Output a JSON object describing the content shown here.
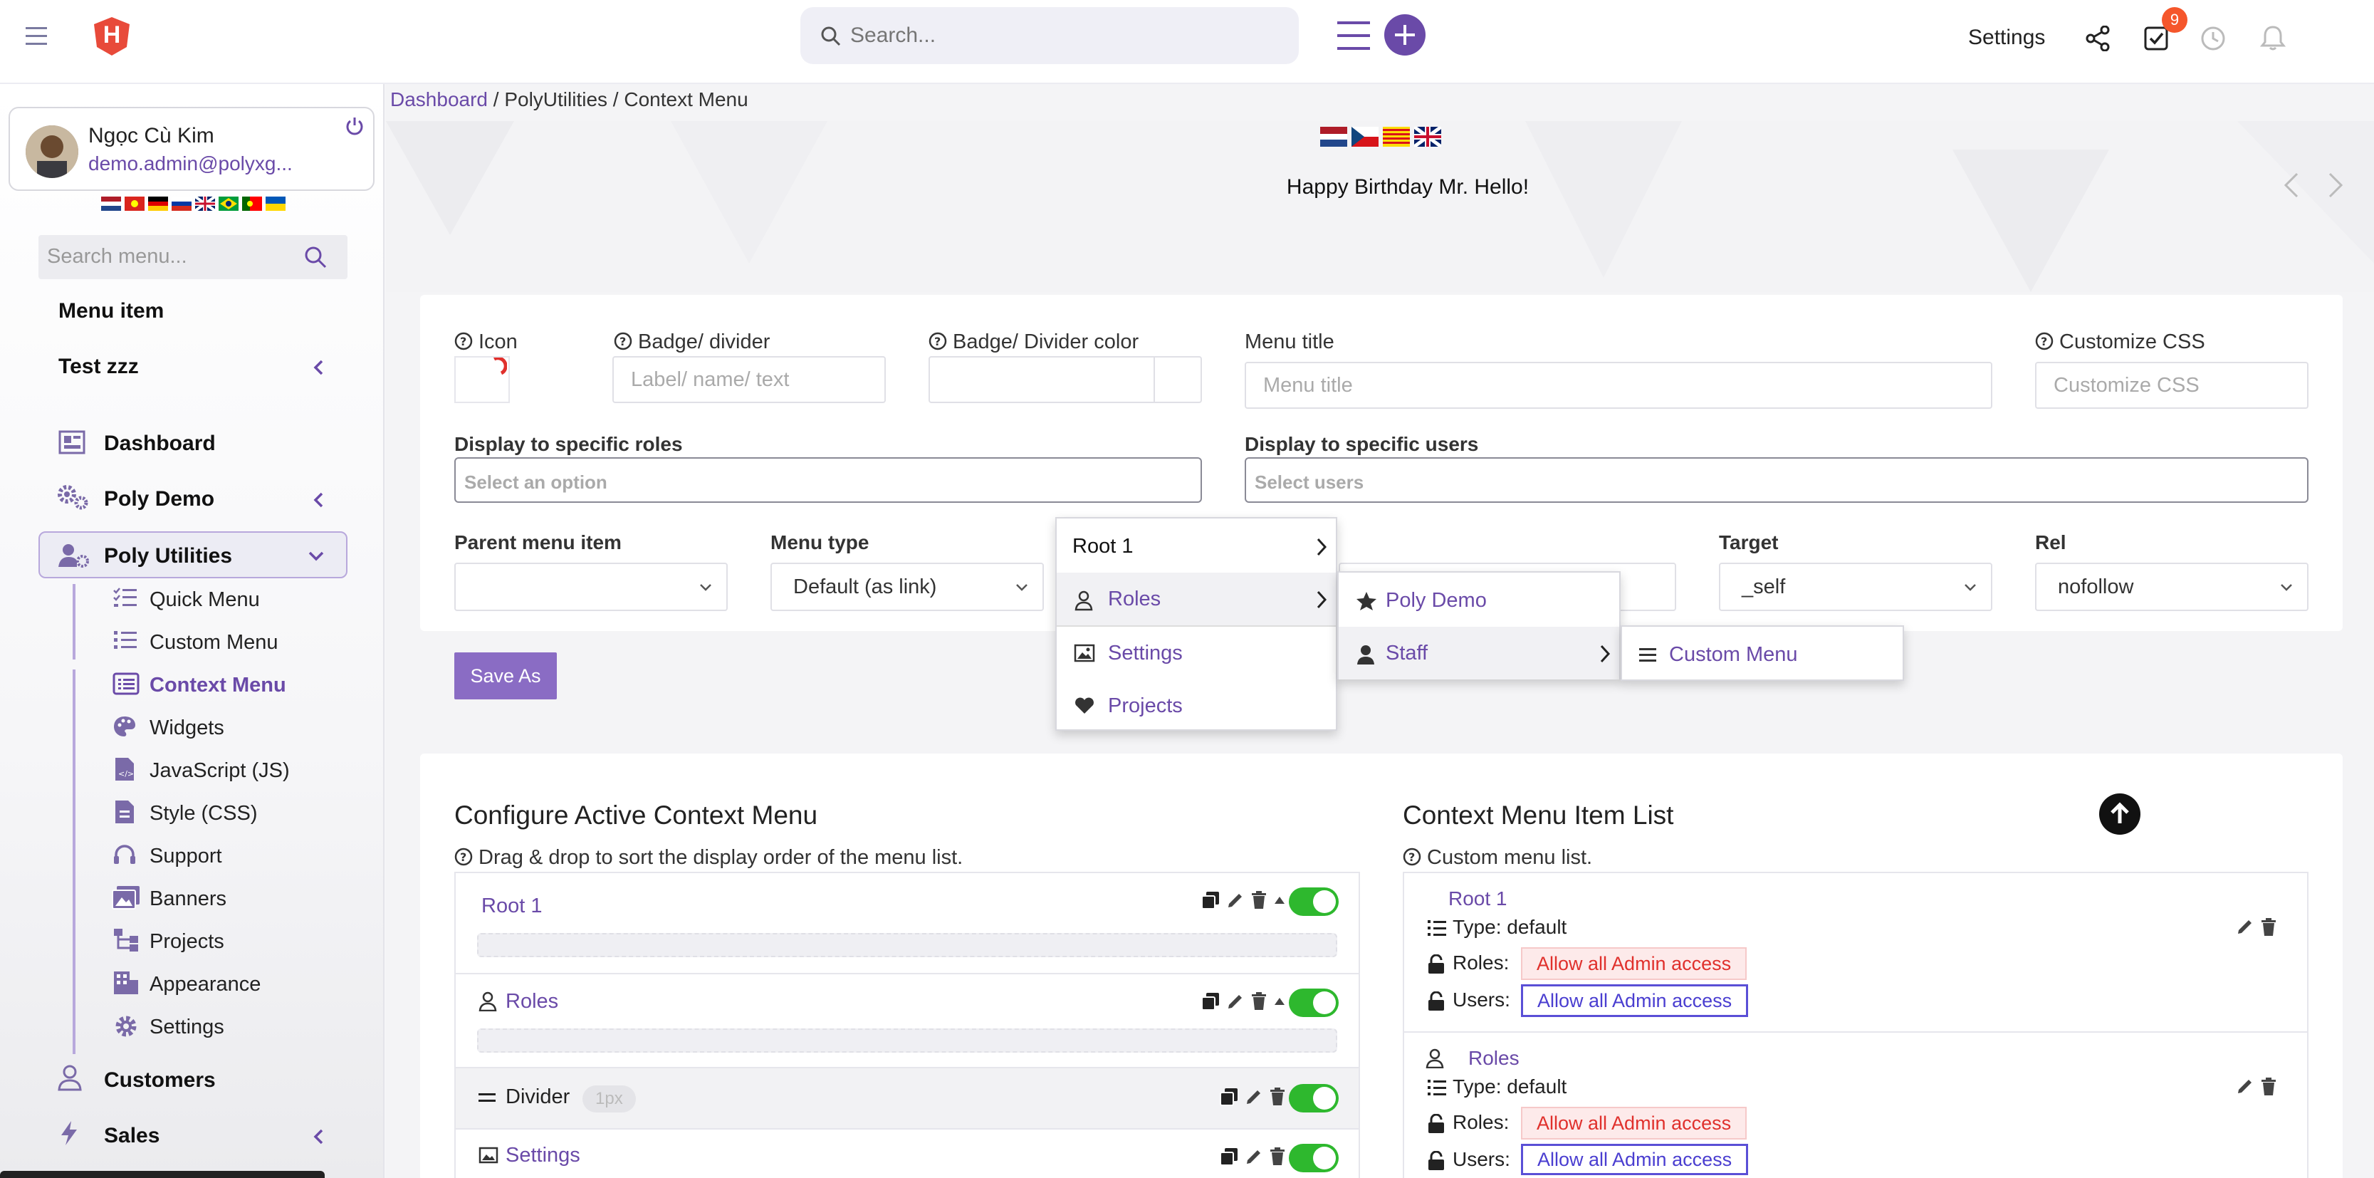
{
  "header": {
    "logo_letter": "H",
    "search_placeholder": "Search...",
    "settings_label": "Settings",
    "notification_count": "9"
  },
  "sidebar": {
    "user_name": "Ngọc Cù Kim",
    "user_email": "demo.admin@polyxg...",
    "search_placeholder": "Search menu...",
    "items": {
      "menu_item": "Menu item",
      "test_zzz": "Test zzz",
      "dashboard": "Dashboard",
      "poly_demo": "Poly Demo",
      "poly_utilities": "Poly Utilities",
      "customers": "Customers",
      "sales": "Sales"
    },
    "sub_items": [
      "Quick Menu",
      "Custom Menu",
      "Context Menu",
      "Widgets",
      "JavaScript (JS)",
      "Style (CSS)",
      "Support",
      "Banners",
      "Projects",
      "Appearance",
      "Settings"
    ]
  },
  "breadcrumb": {
    "home": "Dashboard",
    "sep1": " / PolyUtilities / Context Menu"
  },
  "banner": {
    "text": "Happy Birthday Mr. Hello!"
  },
  "form": {
    "icon_label": "Icon",
    "badge_label": "Badge/ divider",
    "badge_placeholder": "Label/ name/ text",
    "badge_color_label": "Badge/ Divider color",
    "menu_title_label": "Menu title",
    "menu_title_placeholder": "Menu title",
    "css_label": "Customize CSS",
    "css_placeholder": "Customize CSS",
    "roles_label": "Display to specific roles",
    "roles_placeholder": "Select an option",
    "users_label": "Display to specific users",
    "users_placeholder": "Select users",
    "parent_label": "Parent menu item",
    "menu_type_label": "Menu type",
    "menu_type_value": "Default (as link)",
    "target_label": "Target",
    "target_value": "_self",
    "rel_label": "Rel",
    "rel_value": "nofollow",
    "save_button": "Save As"
  },
  "context_menu": {
    "level1": [
      "Root 1",
      "Roles",
      "Settings",
      "Projects"
    ],
    "level2": [
      "Poly Demo",
      "Staff"
    ],
    "level3": [
      "Custom Menu"
    ]
  },
  "configure": {
    "title": "Configure Active Context Menu",
    "hint": "Drag & drop to sort the display order of the menu list.",
    "rows": [
      {
        "label": "Root 1"
      },
      {
        "label": "Roles"
      },
      {
        "label": "Divider",
        "badge": "1px"
      },
      {
        "label": "Settings"
      }
    ]
  },
  "item_list": {
    "title": "Context Menu Item List",
    "hint": "Custom menu list.",
    "items": [
      {
        "name": "Root 1",
        "type": "Type: default",
        "roles_label": "Roles:",
        "roles_value": "Allow all Admin access",
        "users_label": "Users:",
        "users_value": "Allow all Admin access"
      },
      {
        "name": "Roles",
        "type": "Type: default",
        "roles_label": "Roles:",
        "roles_value": "Allow all Admin access",
        "users_label": "Users:",
        "users_value": "Allow all Admin access"
      }
    ]
  },
  "colors": {
    "accent": "#6a4aa8",
    "toggle_on": "#2eb82e",
    "danger": "#e0302c",
    "badge": "#f5562b"
  }
}
